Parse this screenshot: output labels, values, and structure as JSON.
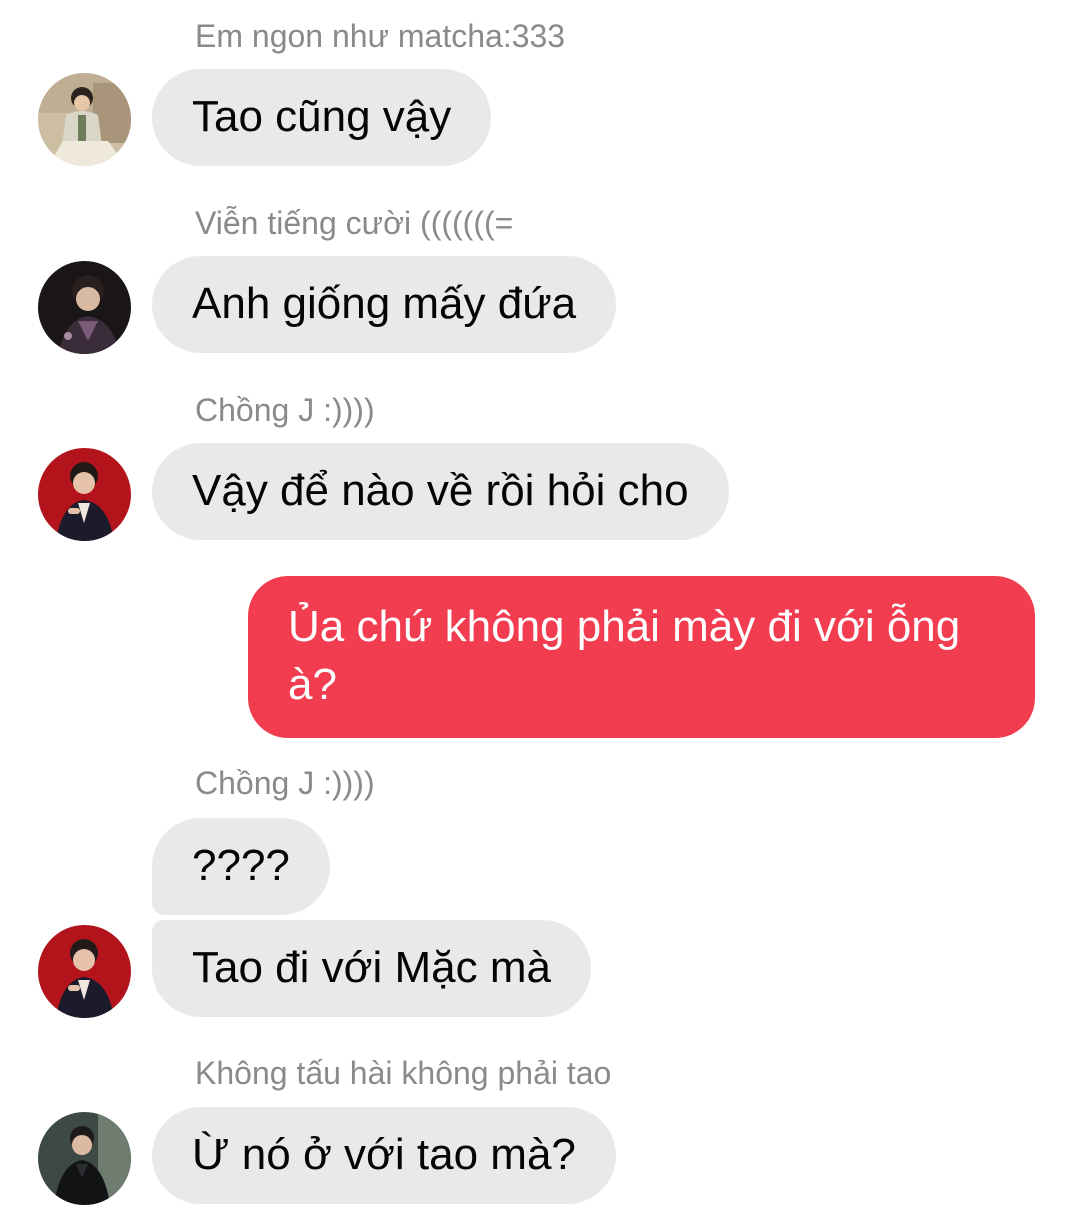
{
  "messages": [
    {
      "sender": "Em ngon như matcha:333",
      "avatar": "avatar-man-light-shirt",
      "texts": [
        "Tao cũng vậy"
      ]
    },
    {
      "sender": "Viễn tiếng cười (((((((=",
      "avatar": "avatar-man-dark-portrait",
      "texts": [
        "Anh giống mấy đứa"
      ]
    },
    {
      "sender": "Chồng J :))))",
      "avatar": "avatar-man-red-background",
      "texts": [
        "Vậy để nào về rồi hỏi cho"
      ]
    },
    {
      "sender": "",
      "outgoing": true,
      "texts": [
        "Ủa chứ không phải mày đi với ỗng à?"
      ]
    },
    {
      "sender": "Chồng J :))))",
      "avatar": "avatar-man-red-background",
      "texts": [
        "????",
        "Tao đi với Mặc mà"
      ]
    },
    {
      "sender": "Không tấu hài không phải tao",
      "avatar": "avatar-man-dark-suit",
      "texts": [
        "Ừ nó ở với tao mà?"
      ]
    }
  ],
  "colors": {
    "incoming_bubble": "#e9e9eb",
    "outgoing_bubble": "#f23c4f",
    "sender_name": "#8a8a8a"
  }
}
